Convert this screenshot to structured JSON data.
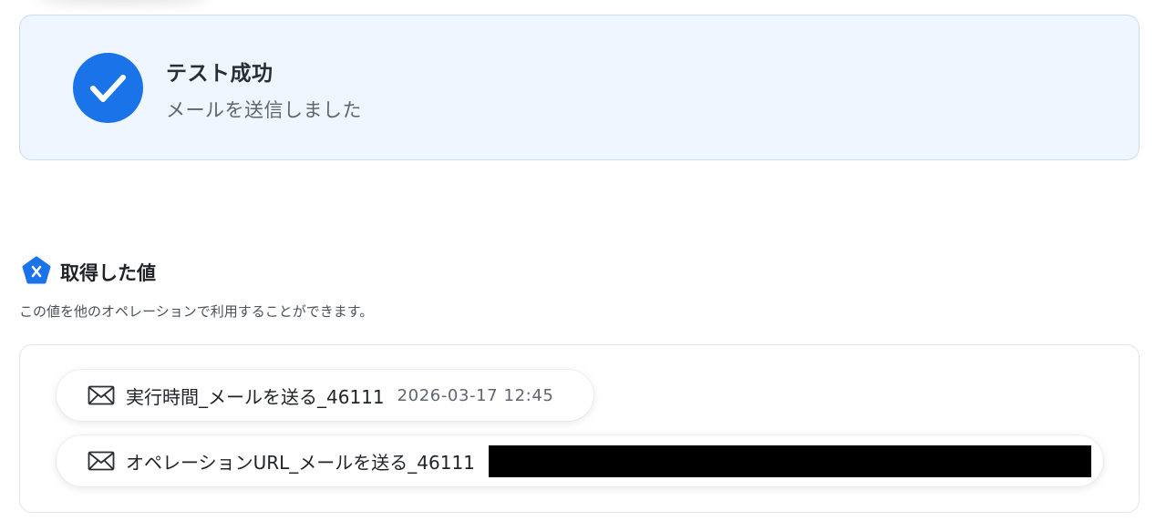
{
  "result": {
    "title": "テスト成功",
    "message": "メールを送信しました"
  },
  "section": {
    "title": "取得した値",
    "description": "この値を他のオペレーションで利用することができます。"
  },
  "values": [
    {
      "label": "実行時間_メールを送る_46111",
      "value": "2026-03-17 12:45",
      "icon": "mail-icon"
    },
    {
      "label": "オペレーションURL_メールを送る_46111",
      "value": "",
      "icon": "mail-icon"
    }
  ],
  "colors": {
    "accent": "#1a73e8",
    "card_bg": "#eff6ff",
    "redaction": "#000000"
  }
}
